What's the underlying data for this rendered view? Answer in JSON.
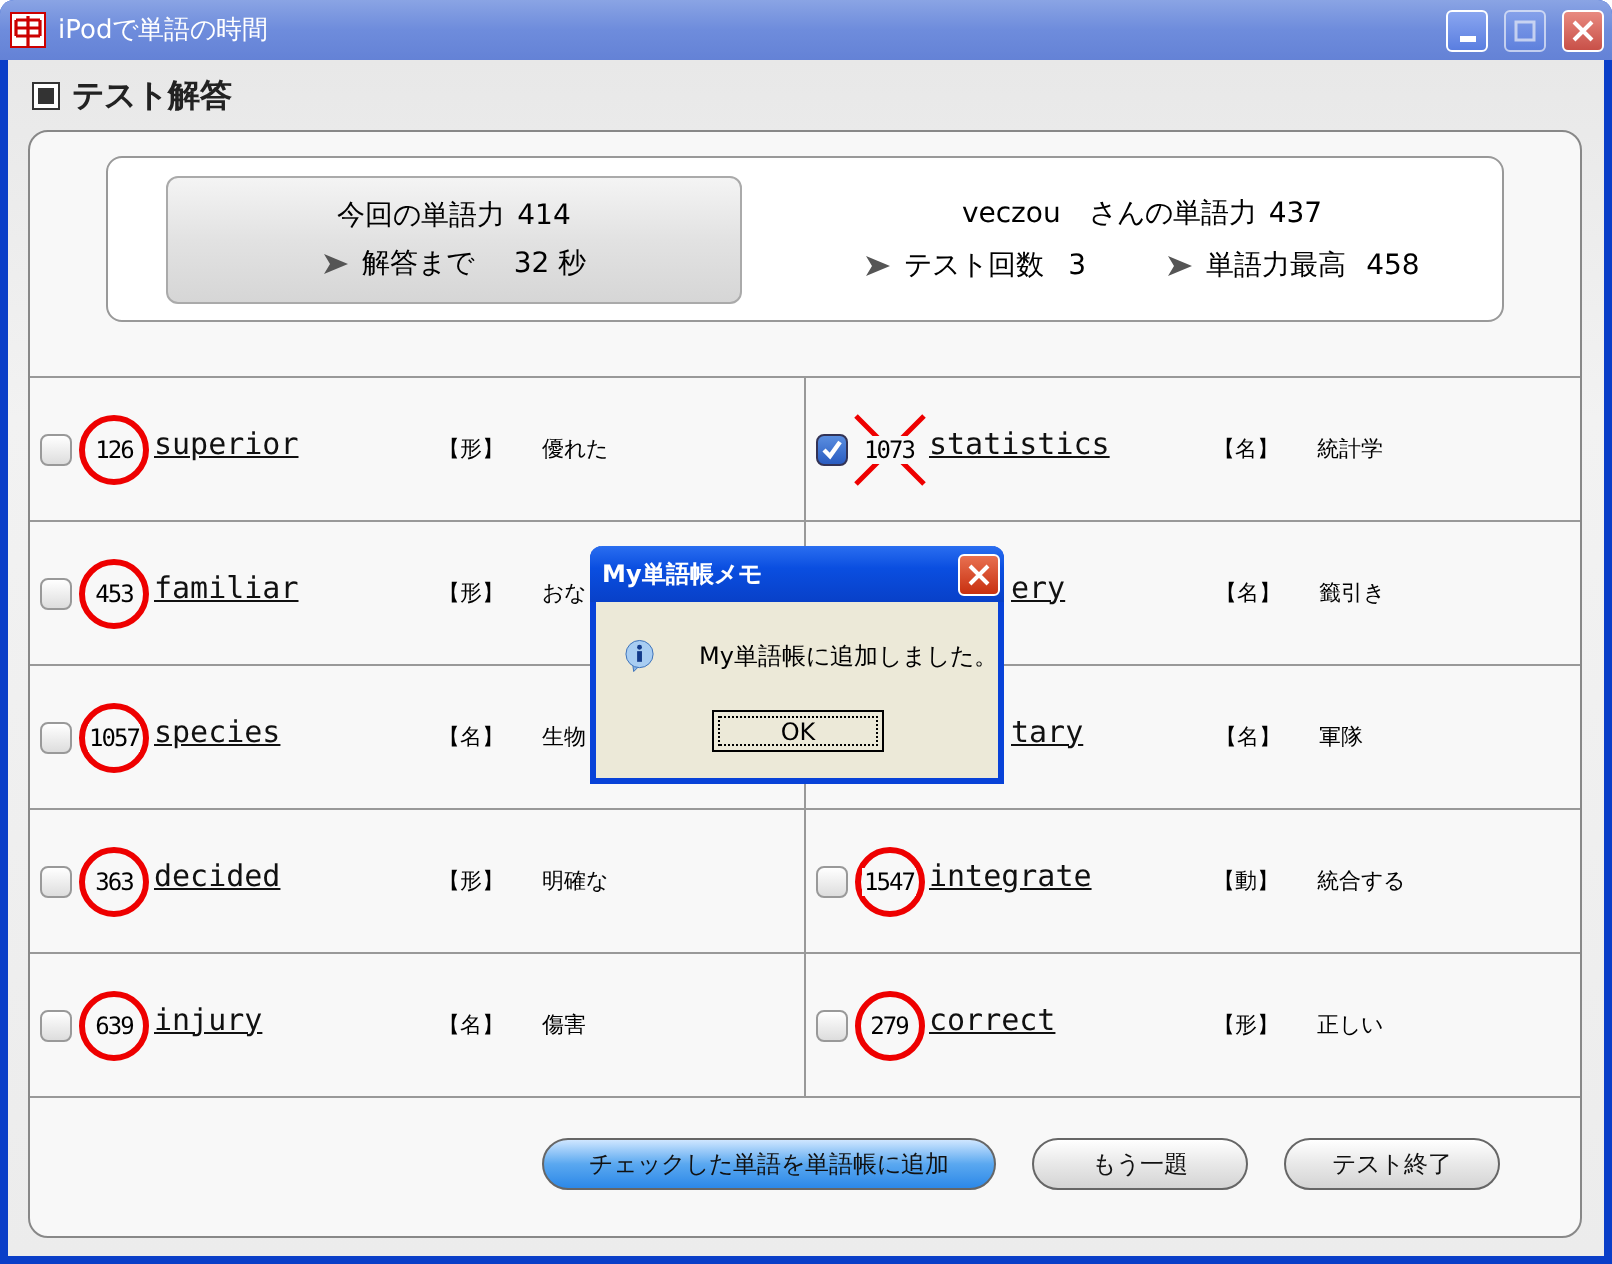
{
  "window": {
    "title": "iPodで単語の時間"
  },
  "section_title": "テスト解答",
  "summary": {
    "score_label": "今回の単語力",
    "score": "414",
    "timer_label": "解答まで",
    "timer": "32 秒",
    "user": "veczou",
    "user_score_label": "さんの単語力",
    "user_score": "437",
    "tests_label": "テスト回数",
    "tests": "3",
    "best_label": "単語力最高",
    "best": "458"
  },
  "columns": [
    [
      {
        "kind": "full",
        "checked": false,
        "number": "126",
        "correct": true,
        "word": "superior",
        "pos": "【形】",
        "meaning": "優れた"
      },
      {
        "kind": "full",
        "checked": false,
        "number": "453",
        "correct": true,
        "word": "familiar",
        "pos": "【形】",
        "meaning": "おな"
      },
      {
        "kind": "full",
        "checked": false,
        "number": "1057",
        "correct": true,
        "word": "species",
        "pos": "【名】",
        "meaning": "生物"
      },
      {
        "kind": "full",
        "checked": false,
        "number": "363",
        "correct": true,
        "word": "decided",
        "pos": "【形】",
        "meaning": "明確な"
      },
      {
        "kind": "full",
        "checked": false,
        "number": "639",
        "correct": true,
        "word": "injury",
        "pos": "【名】",
        "meaning": "傷害"
      }
    ],
    [
      {
        "kind": "full",
        "checked": true,
        "number": "1073",
        "correct": false,
        "word": "statistics",
        "pos": "【名】",
        "meaning": "統計学"
      },
      {
        "kind": "covered",
        "word": "ery",
        "pos": "【名】",
        "meaning": "籤引き"
      },
      {
        "kind": "covered",
        "word": "tary",
        "pos": "【名】",
        "meaning": "軍隊"
      },
      {
        "kind": "full",
        "checked": false,
        "number": "1547",
        "correct": true,
        "word": "integrate",
        "pos": "【動】",
        "meaning": "統合する"
      },
      {
        "kind": "full",
        "checked": false,
        "number": "279",
        "correct": true,
        "word": "correct",
        "pos": "【形】",
        "meaning": "正しい"
      }
    ]
  ],
  "buttons": [
    {
      "label": "チェックした単語を単語帳に追加",
      "kind": "primary"
    },
    {
      "label": "もう一題",
      "kind": "normal"
    },
    {
      "label": "テスト終了",
      "kind": "normal"
    }
  ],
  "dialog": {
    "title": "My単語帳メモ",
    "message": "My単語帳に追加しました。",
    "button": "OK"
  }
}
